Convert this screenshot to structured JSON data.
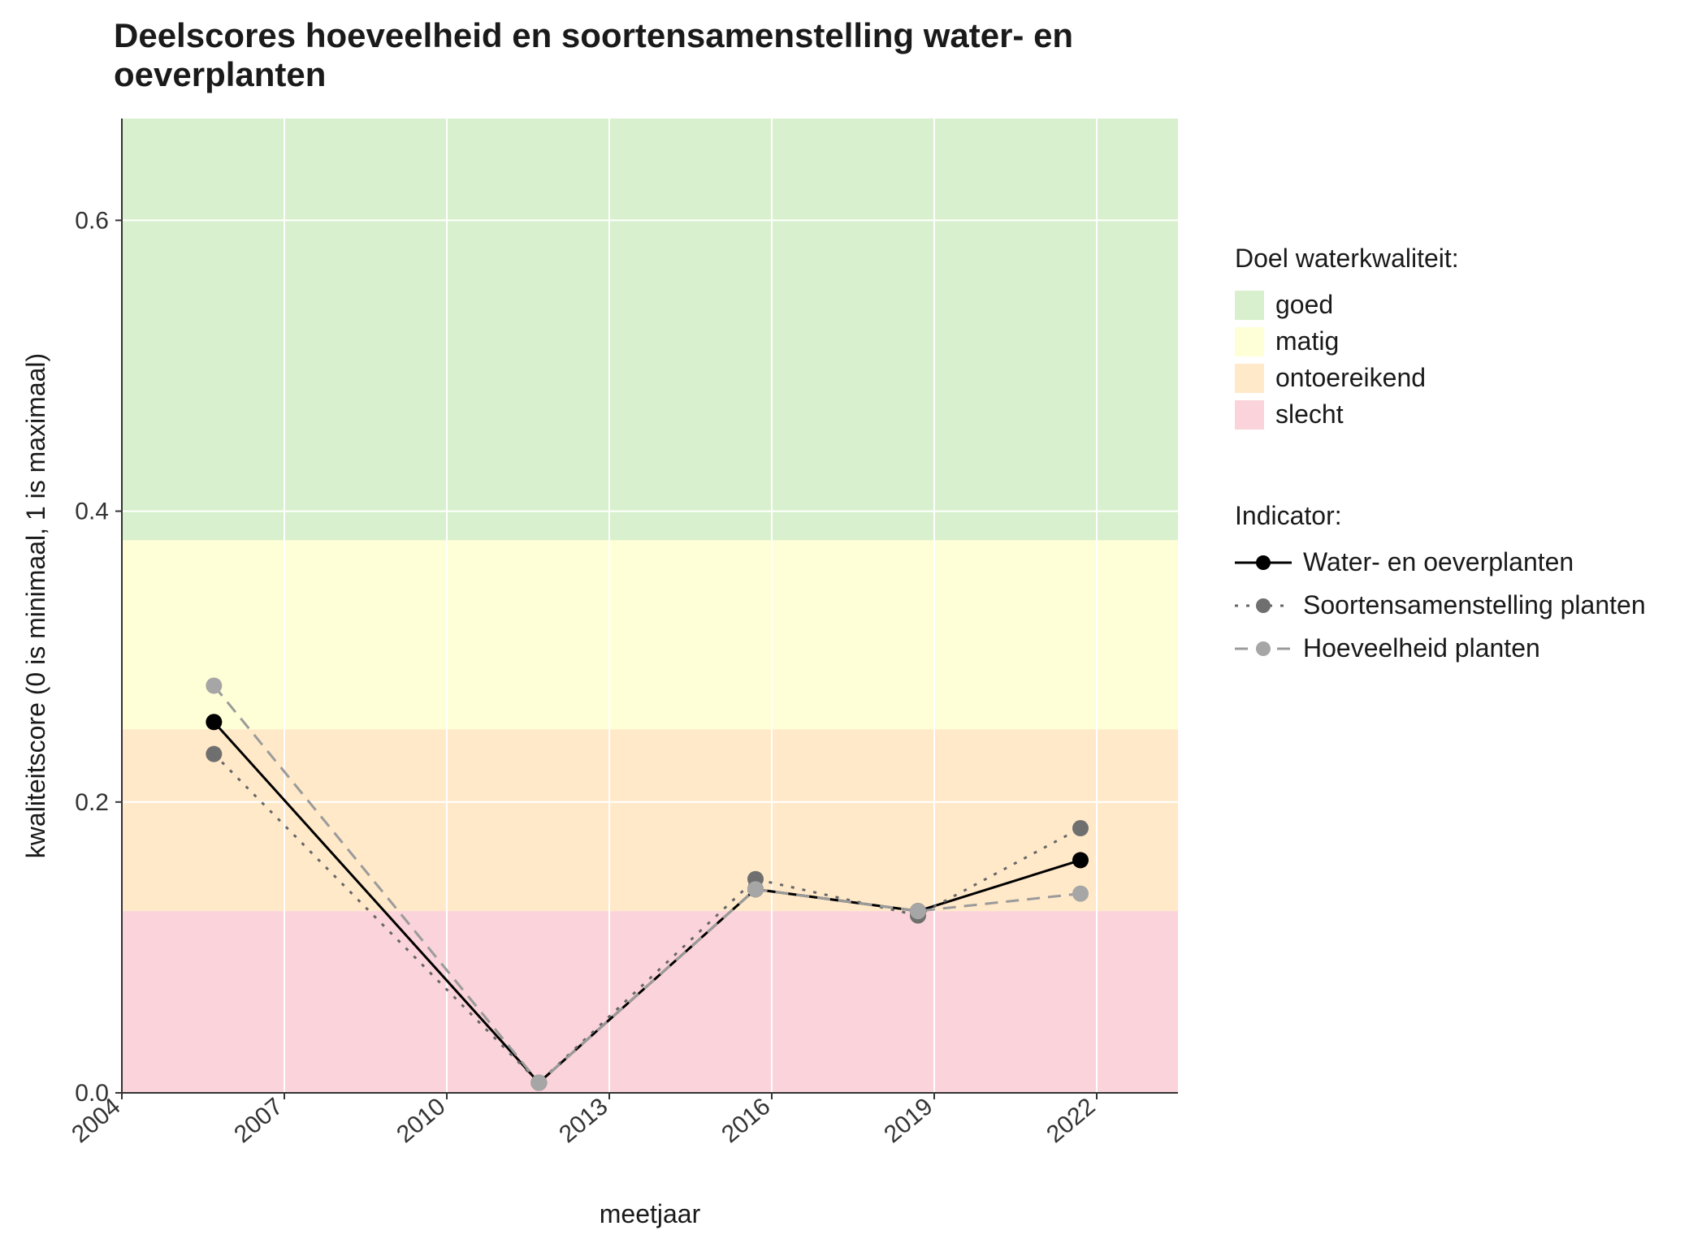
{
  "chart_data": {
    "type": "line",
    "title": "Deelscores hoeveelheid en soortensamenstelling water- en oeverplanten",
    "xlabel": "meetjaar",
    "ylabel": "kwaliteitscore (0 is minimaal, 1 is maximaal)",
    "x_ticks": [
      2004,
      2007,
      2010,
      2013,
      2016,
      2019,
      2022
    ],
    "y_ticks": [
      0.0,
      0.2,
      0.4,
      0.6
    ],
    "xlim": [
      2004,
      2023.5
    ],
    "ylim": [
      0.0,
      0.67
    ],
    "bands": [
      {
        "name": "goed",
        "color": "#d8f0cd",
        "ymin": 0.38,
        "ymax": 0.67
      },
      {
        "name": "matig",
        "color": "#feffd6",
        "ymin": 0.25,
        "ymax": 0.38
      },
      {
        "name": "ontoereikend",
        "color": "#ffe9c9",
        "ymin": 0.125,
        "ymax": 0.25
      },
      {
        "name": "slecht",
        "color": "#fbd3da",
        "ymin": 0.0,
        "ymax": 0.125
      }
    ],
    "x": [
      2005.7,
      2011.7,
      2015.7,
      2018.7,
      2021.7
    ],
    "series": [
      {
        "name": "Water- en oeverplanten",
        "color": "#000000",
        "point_color": "#000000",
        "dash": "solid",
        "values": [
          0.255,
          0.007,
          0.14,
          0.125,
          0.16
        ]
      },
      {
        "name": "Soortensamenstelling planten",
        "color": "#666666",
        "point_color": "#6f6f6f",
        "dash": "dotted",
        "values": [
          0.233,
          0.007,
          0.147,
          0.122,
          0.182
        ]
      },
      {
        "name": "Hoeveelheid planten",
        "color": "#9b9b9b",
        "point_color": "#a6a6a6",
        "dash": "dashed",
        "values": [
          0.28,
          0.007,
          0.14,
          0.125,
          0.137
        ]
      }
    ],
    "legend_quality_title": "Doel waterkwaliteit:",
    "legend_indicator_title": "Indicator:"
  }
}
